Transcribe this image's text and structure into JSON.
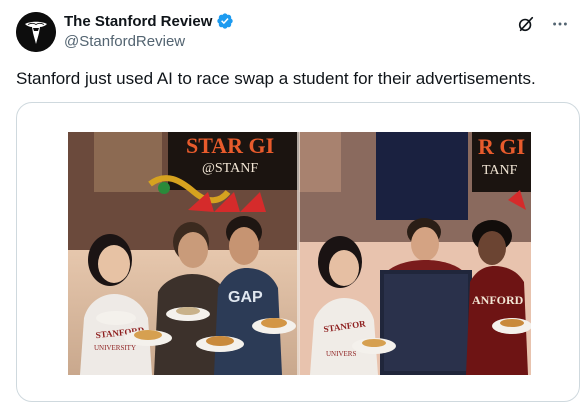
{
  "author": {
    "display_name": "The Stanford Review",
    "handle": "@StanfordReview",
    "verified": true
  },
  "post": {
    "text": "Stanford just used AI to race swap a student for their advertisements."
  },
  "media": {
    "sign_left": "STAR GI",
    "sign_left_sub": "@STANF",
    "sign_right": "R GI",
    "sign_right_sub": "TANF",
    "hoodie_left": "STANFORD",
    "hoodie_left_sub": "UNIVERSITY",
    "shirt_mid": "GAP",
    "hoodie_right": "ANFORD",
    "hoodie_right2": "STANFOR",
    "hoodie_right2_sub": "UNIVERS"
  },
  "colors": {
    "text_primary": "#0f1419",
    "text_secondary": "#536471",
    "verified_blue": "#1d9bf0",
    "border": "#cfd9de"
  },
  "icons": {
    "verified": "verified-badge-icon",
    "grok": "grok-icon",
    "more": "more-dots-icon"
  }
}
